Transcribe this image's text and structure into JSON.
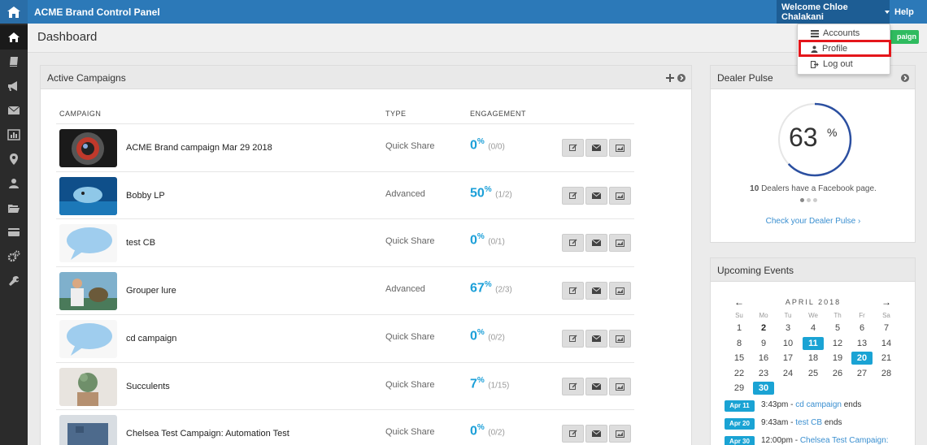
{
  "app": {
    "title": "ACME Brand Control Panel"
  },
  "header": {
    "user_menu": "Welcome Chloe Chalakani",
    "help": "Help"
  },
  "user_dropdown": {
    "items": [
      "Accounts",
      "Profile",
      "Log out"
    ]
  },
  "page": {
    "title": "Dashboard",
    "new_campaign_label": "paign"
  },
  "active_campaigns": {
    "title": "Active Campaigns",
    "columns": [
      "CAMPAIGN",
      "TYPE",
      "ENGAGEMENT"
    ],
    "rows": [
      {
        "name": "ACME Brand campaign Mar 29 2018",
        "type": "Quick Share",
        "eng": "0",
        "frac": "(0/0)"
      },
      {
        "name": "Bobby LP",
        "type": "Advanced",
        "eng": "50",
        "frac": "(1/2)"
      },
      {
        "name": "test CB",
        "type": "Quick Share",
        "eng": "0",
        "frac": "(0/1)"
      },
      {
        "name": "Grouper lure",
        "type": "Advanced",
        "eng": "67",
        "frac": "(2/3)"
      },
      {
        "name": "cd campaign",
        "type": "Quick Share",
        "eng": "0",
        "frac": "(0/2)"
      },
      {
        "name": "Succulents",
        "type": "Quick Share",
        "eng": "7",
        "frac": "(1/15)"
      },
      {
        "name": "Chelsea Test Campaign: Automation Test",
        "type": "Quick Share",
        "eng": "0",
        "frac": "(0/2)"
      }
    ]
  },
  "dealer_pulse": {
    "title": "Dealer Pulse",
    "percent": "63",
    "percent_sign": "%",
    "count": "10",
    "text": "Dealers have a Facebook page.",
    "link": "Check your Dealer Pulse ›"
  },
  "upcoming_events": {
    "title": "Upcoming Events",
    "month": "APRIL 2018",
    "dow": [
      "Su",
      "Mo",
      "Tu",
      "We",
      "Th",
      "Fr",
      "Sa"
    ],
    "weeks": [
      [
        "1",
        "2",
        "3",
        "4",
        "5",
        "6",
        "7"
      ],
      [
        "8",
        "9",
        "10",
        "11",
        "12",
        "13",
        "14"
      ],
      [
        "15",
        "16",
        "17",
        "18",
        "19",
        "20",
        "21"
      ],
      [
        "22",
        "23",
        "24",
        "25",
        "26",
        "27",
        "28"
      ],
      [
        "29",
        "30",
        "",
        "",
        "",
        "",
        ""
      ]
    ],
    "events": [
      {
        "date": "Apr 11",
        "time": "3:43pm - ",
        "link": "cd campaign",
        "suffix": " ends"
      },
      {
        "date": "Apr 20",
        "time": "9:43am - ",
        "link": "test CB",
        "suffix": " ends"
      },
      {
        "date": "Apr 30",
        "time": "12:00pm - ",
        "link": "Chelsea Test Campaign:",
        "suffix": ""
      }
    ]
  }
}
